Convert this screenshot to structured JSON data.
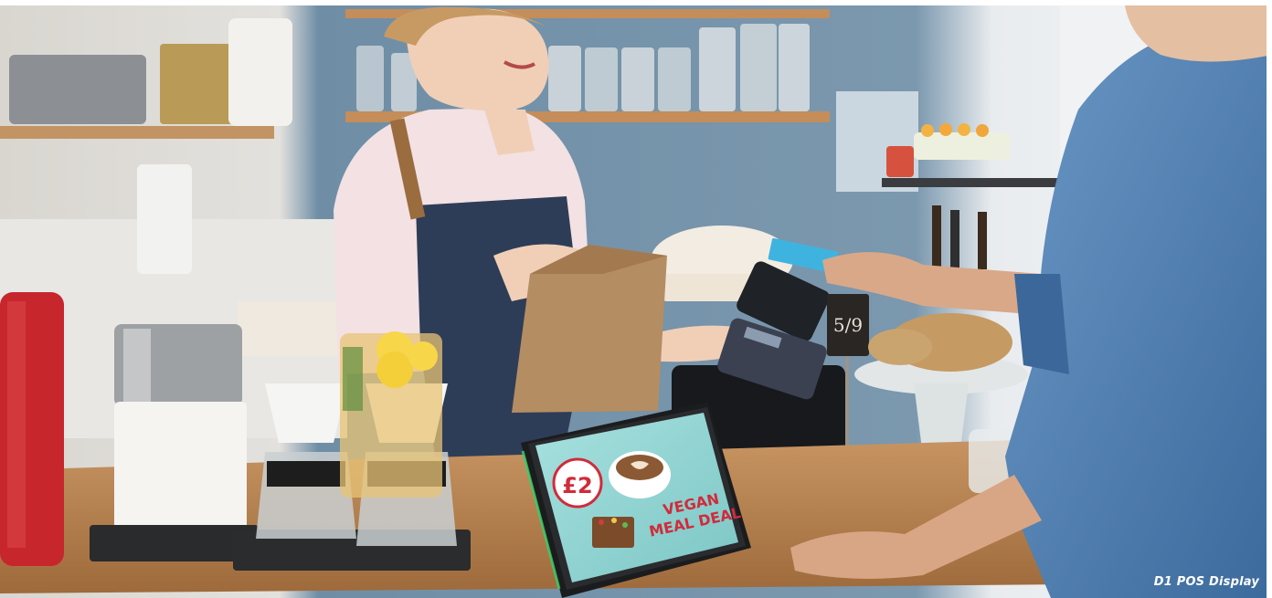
{
  "caption": "D1 POS Display",
  "tablet": {
    "price": "£2",
    "line1": "VEGAN",
    "line2": "MEAL DEAL"
  },
  "price_tag": "5/9",
  "colors": {
    "wall_blue": "#6e8fa7",
    "counter_wood": "#b8854f",
    "apron": "#2e3d57",
    "shirt_pink": "#f3e1e3",
    "customer_shirt": "#4f7fb2",
    "screen_teal": "#8fd3d1",
    "screen_red": "#d12b3a",
    "card_blue": "#3fb3e0",
    "caption_text": "#ffffff"
  }
}
